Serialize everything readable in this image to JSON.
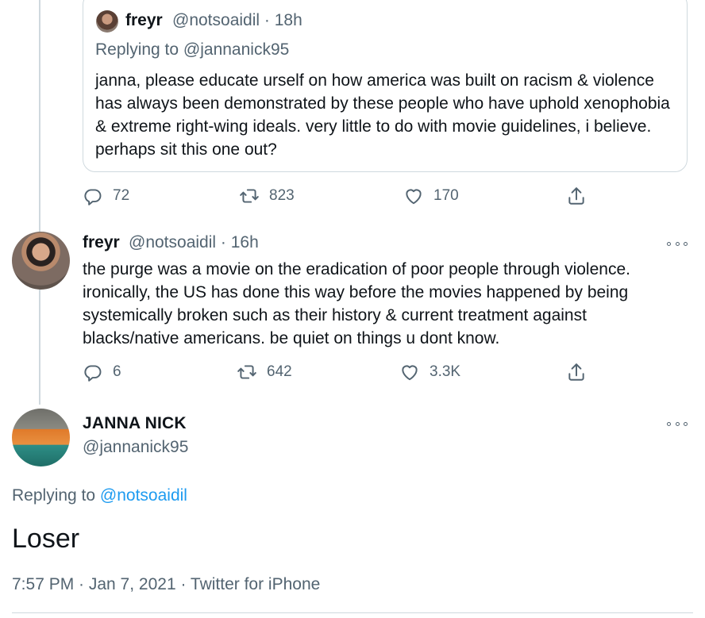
{
  "quoted_tweet": {
    "name": "freyr",
    "handle_time": "@notsoaidil · 18h",
    "replying_prefix": "Replying to ",
    "replying_to": "@jannanick95",
    "text": "janna, please educate urself on how america was built on racism & violence has always been demonstrated by these people who have uphold xenophobia & extreme right-wing ideals. very little to do with movie guidelines, i believe. perhaps sit this one out?",
    "replies": "72",
    "retweets": "823",
    "likes": "170"
  },
  "tweet2": {
    "name": "freyr",
    "handle_time": "@notsoaidil · 16h",
    "text": "the purge was a movie on the eradication of poor people through violence. ironically, the US has done this way before the movies happened by being systemically broken such as their history & current treatment against blacks/native americans. be quiet on things u dont know.",
    "replies": "6",
    "retweets": "642",
    "likes": "3.3K"
  },
  "tweet3": {
    "name": "JANNA NICK",
    "handle": "@jannanick95",
    "replying_prefix": "Replying to ",
    "replying_to": "@notsoaidil",
    "text": "Loser",
    "meta": "7:57 PM · Jan 7, 2021 · Twitter for iPhone"
  },
  "icons": {
    "reply": "reply-icon",
    "retweet": "retweet-icon",
    "like": "heart-icon",
    "share": "share-icon",
    "more": "more-icon"
  },
  "colors": {
    "link": "#1d9bf0",
    "secondary_text": "#536471",
    "border": "#cfd9de"
  }
}
